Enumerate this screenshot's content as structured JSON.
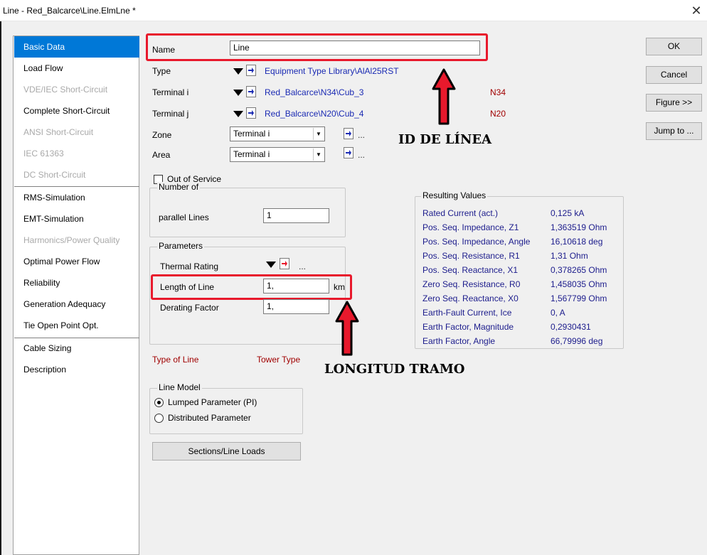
{
  "window": {
    "title": "Line - Red_Balcarce\\Line.ElmLne *",
    "close_glyph": "✕"
  },
  "sidebar": {
    "items": [
      {
        "label": "Basic Data",
        "state": "selected"
      },
      {
        "label": "Load Flow",
        "state": "normal"
      },
      {
        "label": "VDE/IEC Short-Circuit",
        "state": "disabled"
      },
      {
        "label": "Complete Short-Circuit",
        "state": "normal"
      },
      {
        "label": "ANSI Short-Circuit",
        "state": "disabled"
      },
      {
        "label": "IEC 61363",
        "state": "disabled"
      },
      {
        "label": "DC Short-Circuit",
        "state": "disabled"
      },
      {
        "label": "RMS-Simulation",
        "state": "normal"
      },
      {
        "label": "EMT-Simulation",
        "state": "normal"
      },
      {
        "label": "Harmonics/Power Quality",
        "state": "disabled"
      },
      {
        "label": "Optimal Power Flow",
        "state": "normal"
      },
      {
        "label": "Reliability",
        "state": "normal"
      },
      {
        "label": "Generation Adequacy",
        "state": "normal"
      },
      {
        "label": "Tie Open Point Opt.",
        "state": "normal"
      },
      {
        "label": "Cable Sizing",
        "state": "normal"
      },
      {
        "label": "Description",
        "state": "normal"
      }
    ]
  },
  "form": {
    "name_label": "Name",
    "name_value": "Line",
    "type_label": "Type",
    "type_value": "Equipment Type Library\\AlAl25RST",
    "terminal_i_label": "Terminal i",
    "terminal_i_value": "Red_Balcarce\\N34\\Cub_3",
    "terminal_i_node": "N34",
    "terminal_j_label": "Terminal j",
    "terminal_j_value": "Red_Balcarce\\N20\\Cub_4",
    "terminal_j_node": "N20",
    "zone_label": "Zone",
    "zone_value": "Terminal i",
    "area_label": "Area",
    "area_value": "Terminal i",
    "dots": "...",
    "out_of_service_label": "Out of Service",
    "out_of_service_checked": false
  },
  "number_of": {
    "group_label": "Number of",
    "parallel_label": "parallel Lines",
    "parallel_value": "1"
  },
  "parameters": {
    "group_label": "Parameters",
    "thermal_label": "Thermal Rating",
    "length_label": "Length of Line",
    "length_value": "1,",
    "length_unit": "km",
    "derating_label": "Derating Factor",
    "derating_value": "1,"
  },
  "type_of_line": "Type of Line",
  "tower_type": "Tower Type",
  "line_model": {
    "group_label": "Line Model",
    "options": [
      {
        "label": "Lumped Parameter (PI)",
        "selected": true
      },
      {
        "label": "Distributed Parameter",
        "selected": false
      }
    ]
  },
  "sections_button": "Sections/Line Loads",
  "resulting": {
    "group_label": "Resulting Values",
    "rows": [
      {
        "label": "Rated Current (act.)",
        "value": "0,125 kA"
      },
      {
        "label": "Pos. Seq. Impedance, Z1",
        "value": "1,363519 Ohm"
      },
      {
        "label": "Pos. Seq. Impedance, Angle",
        "value": "16,10618 deg"
      },
      {
        "label": "Pos. Seq. Resistance, R1",
        "value": "1,31 Ohm"
      },
      {
        "label": "Pos. Seq. Reactance, X1",
        "value": "0,378265 Ohm"
      },
      {
        "label": "Zero Seq. Resistance, R0",
        "value": "1,458035 Ohm"
      },
      {
        "label": "Zero Seq. Reactance, X0",
        "value": "1,567799 Ohm"
      },
      {
        "label": "Earth-Fault Current, Ice",
        "value": "0, A"
      },
      {
        "label": "Earth Factor, Magnitude",
        "value": "0,2930431"
      },
      {
        "label": "Earth Factor, Angle",
        "value": "66,79996 deg"
      }
    ]
  },
  "buttons": {
    "ok": "OK",
    "cancel": "Cancel",
    "figure": "Figure >>",
    "jump": "Jump to ..."
  },
  "annotations": {
    "id_de_linea": "ID DE LÍNEA",
    "longitud_tramo": "LONGITUD TRAMO"
  },
  "colors": {
    "highlight_red": "#e8192c",
    "selection_blue": "#0078d7",
    "link_blue": "#1a2ab3",
    "node_red": "#a00000"
  }
}
